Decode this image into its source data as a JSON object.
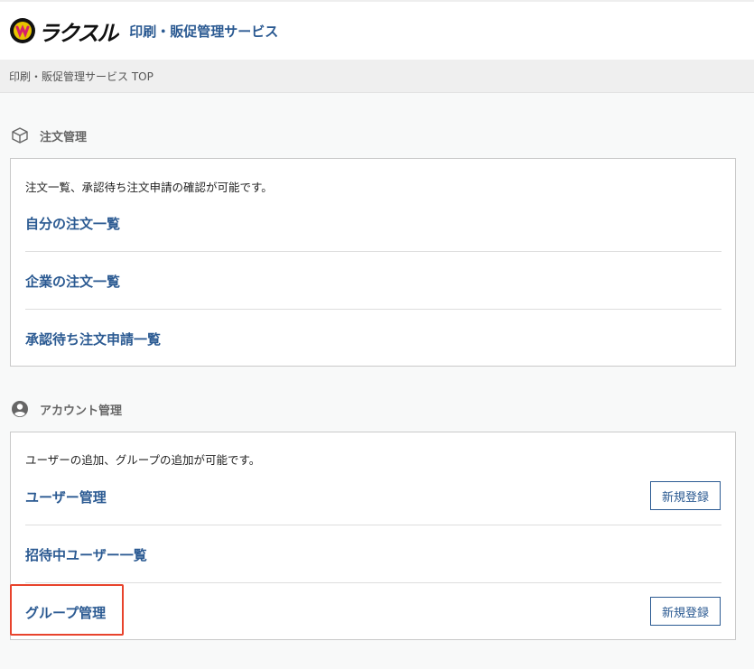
{
  "header": {
    "logo_text": "ラクスル",
    "service_title": "印刷・販促管理サービス"
  },
  "breadcrumb": "印刷・販促管理サービス TOP",
  "sections": {
    "orders": {
      "title": "注文管理",
      "icon": "box-icon",
      "description": "注文一覧、承認待ち注文申請の確認が可能です。",
      "links": [
        "自分の注文一覧",
        "企業の注文一覧",
        "承認待ち注文申請一覧"
      ]
    },
    "accounts": {
      "title": "アカウント管理",
      "icon": "user-circle-icon",
      "description": "ユーザーの追加、グループの追加が可能です。",
      "links": [
        "ユーザー管理",
        "招待中ユーザー一覧",
        "グループ管理"
      ],
      "register_label": "新規登録"
    }
  },
  "colors": {
    "link": "#2b5a92",
    "highlight": "#e8432c"
  }
}
